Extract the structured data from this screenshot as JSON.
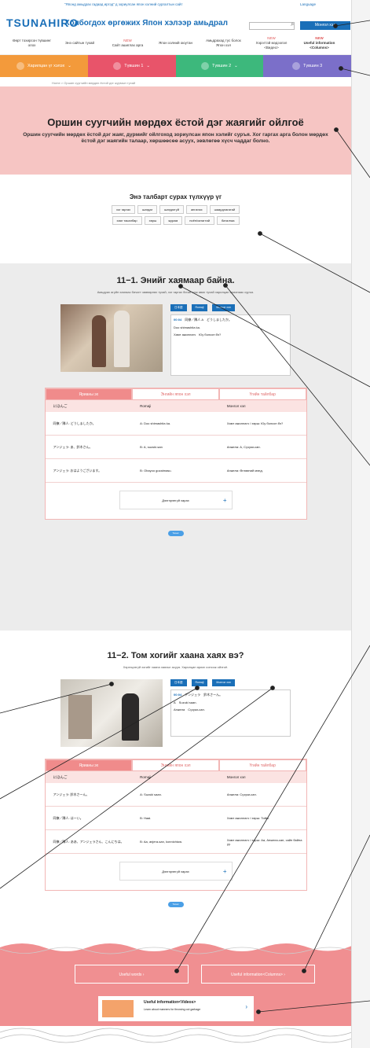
{
  "header": {
    "logo": "TSUNAHIRO",
    "caption": "“Японд амьдрах гадаад иргэд” д зориулсан япон хэлний сургалтын сайт",
    "title": "Холбогдох өргөжих Япон хэлээр амьдрал",
    "lang_link": "Language",
    "search_placeholder": "",
    "mongol_button": "Монгол хэл"
  },
  "nav": [
    {
      "new": "",
      "label": "Өөрт тохирсон түвшинг олох"
    },
    {
      "new": "",
      "label": "Энэ сайтын тухай"
    },
    {
      "new": "NEW",
      "label": "Сайт ашиглах арга"
    },
    {
      "new": "",
      "label": "Япон хэлний оюутан"
    },
    {
      "new": "",
      "label": "Амьдрахад тус болох Япон хэл"
    },
    {
      "new": "NEW",
      "label": "Хэрэгтэй мэдээлэл <Видео>"
    },
    {
      "new": "NEW",
      "label": "Useful information <Columns>"
    }
  ],
  "tabs": [
    {
      "label": "Харилцан үг хэлэх",
      "color": "#f39a3b"
    },
    {
      "label": "Түвшин 1",
      "color": "#e8546a"
    },
    {
      "label": "Түвшин 2",
      "color": "#3db87c"
    },
    {
      "label": "Түвшин 3",
      "color": "#7b6fc9"
    }
  ],
  "breadcrumb": "Home  >  Оршин суугчийн мөрдөх ёстой дэг журмын тухай",
  "hero": {
    "title": "Оршин суугчийн мөрдөх ёстой дэг жаягийг ойлгоё",
    "subtitle": "Оршин суугчийн мөрдөх ёстой дэг жаяг, дүрмийг ойлгоход зориулсан япон хэлийг суръя. Хог гаргах арга болон мөрдөх ёстой дэг жаягийн талаар, хөршөөсөө асуух, зөвлөгөө хүсч чаддаг болно."
  },
  "keywords": {
    "title": "Энэ талбарт сурах түлхүүр үг",
    "items": [
      "хог гаргах",
      "шатдаг",
      "шатдаггүй",
      "ангилах",
      "шаардлагатай",
      "хаяг тасалбар",
      "хөрш",
      "журам",
      "ноён/хатагтай",
      "баталгаа",
      "ойлгох",
      "том хог"
    ]
  },
  "section1": {
    "title": "11−1. Энийг хаямаар байна.",
    "desc": "Амьдрах агуйн хаягаас бичигт зөөвөрлөх тухай, хог гаргах бичиг олж авах тухай харилцан ярианаас суръя.",
    "script_btns": [
      "日本語",
      "Romaji",
      "Монгол хэл"
    ],
    "script_lines": [
      {
        "time": "00:04",
        "speaker": "同僚／隣人 A",
        "text": "どうしましたか。"
      },
      {
        "time": "",
        "speaker": "",
        "text": "Doo shimashita ka."
      },
      {
        "time": "",
        "speaker": "Хамт ажиллагч",
        "text": "Юу болсон бэ?"
      }
    ],
    "panel_tabs": [
      "Ярианы эх",
      "Энгийн япон хэл",
      "Үгийн тайлбар"
    ],
    "panel_head": [
      "にほんご",
      "Romaji",
      "Монгол хэл"
    ],
    "rows": [
      [
        "同僚／隣人:  どうしましたか。",
        "A:  Doo shimashita ka.",
        "Хамт ажиллагч / хөрш:  Юу болсон бэ?"
      ],
      [
        "アンジェラ:  あ、鈴木さん。",
        "B:  A, suzuki-san",
        "Анжела:  А, Сүзүки-сан."
      ],
      [
        "アンジェラ:  おはようございます。",
        "B:  Ohayoo gozaimasu.",
        "Анжела:  Өглөөний мэнд."
      ]
    ],
    "more_label": "Дэлгэрэнгүй харах",
    "tweet": "Tweet"
  },
  "section2": {
    "title": "11−2. Том хогийг хаана хаях вэ?",
    "desc": "Хэрэгцээгүй хогийг хаана хаяхыг асууя. Харилцан яриаг сонсож ойлгоё.",
    "script_lines": [
      {
        "time": "00:04",
        "speaker": "アンジェラ",
        "text": "鈴木さーん。"
      },
      {
        "time": "",
        "speaker": "A",
        "text": "Suzuki saan."
      },
      {
        "time": "",
        "speaker": "Анжела",
        "text": "Сүзүки-сан."
      }
    ],
    "rows": [
      [
        "アンジェラ:  鈴木さーん。",
        "A:  Suzuki saan.",
        "Анжела:  Сүзүки-сан."
      ],
      [
        "同僚／隣人:  はーい。",
        "B:  Haai.",
        "Хамт ажиллагч / хөрш:  Тийм."
      ],
      [
        "同僚／隣人:  ああ、アンジェラさん、こんにちは。",
        "B:  Aa, anjera-san, konnichiwa.",
        "Хамт ажиллагч / хөрш:  Аа, Анжела-сан, сайн байна уу."
      ]
    ],
    "tweet": "Tweet"
  },
  "footer": {
    "words": "Useful words",
    "columns": "Useful information<Columns>",
    "videos_title": "Useful information<Videos>",
    "videos_sub": "Learn about manners for throwing out garbage"
  }
}
